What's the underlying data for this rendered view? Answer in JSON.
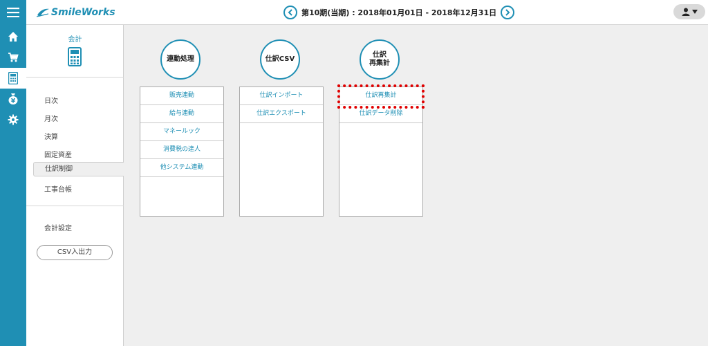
{
  "app": {
    "logo_text": "SmileWorks"
  },
  "header": {
    "period": "第10期(当期) : 2018年01月01日 - 2018年12月31日"
  },
  "rail": {
    "items": [
      {
        "icon": "home-icon"
      },
      {
        "icon": "cart-icon"
      },
      {
        "icon": "calculator-icon",
        "active": true
      },
      {
        "icon": "money-bag-icon"
      },
      {
        "icon": "gear-icon"
      }
    ]
  },
  "sidebar": {
    "title": "会計",
    "items": [
      "日次",
      "月次",
      "決算",
      "固定資産",
      "仕訳制御",
      "工事台帳"
    ],
    "active_index": 4,
    "settings": "会計設定",
    "csv_button": "CSV入出力"
  },
  "cards": [
    {
      "title": "連動処理",
      "items": [
        "販売連動",
        "給与連動",
        "マネールック",
        "消費税の達人",
        "他システム連動"
      ]
    },
    {
      "title": "仕訳CSV",
      "items": [
        "仕訳インポート",
        "仕訳エクスポート"
      ]
    },
    {
      "title_line1": "仕訳",
      "title_line2": "再集計",
      "items": [
        "仕訳再集計",
        "仕訳データ削除"
      ]
    }
  ],
  "colors": {
    "accent": "#1f8fb4",
    "highlight": "#e00000"
  }
}
